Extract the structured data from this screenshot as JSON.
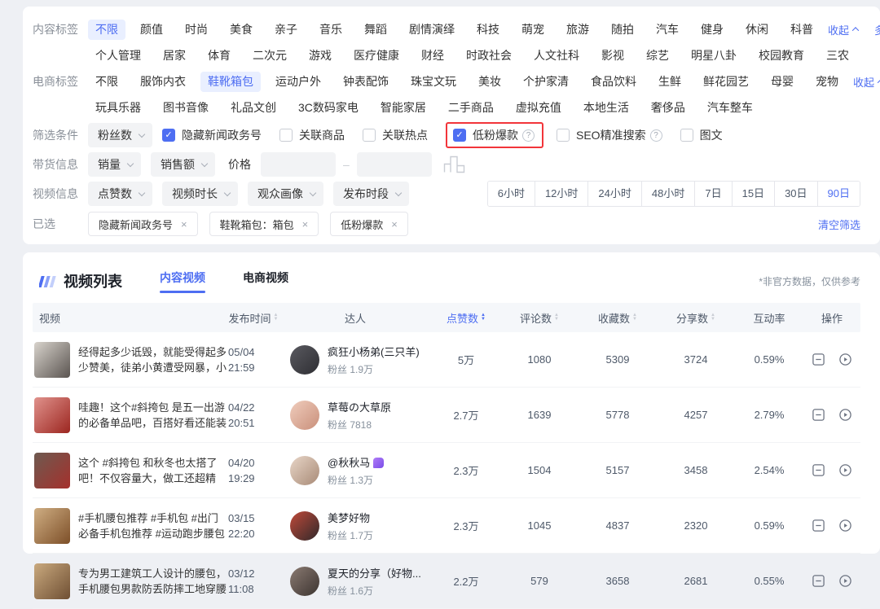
{
  "colors": {
    "accent_blue": "#4e6ef2",
    "accent_blue_bg": "#e9efff",
    "highlight_red": "#f2353a",
    "table_header_bg": "#f5f7fa"
  },
  "filter_panel": {
    "content_tags": {
      "label": "内容标签",
      "row1": [
        "不限",
        "颜值",
        "时尚",
        "美食",
        "亲子",
        "音乐",
        "舞蹈",
        "剧情演绎",
        "科技",
        "萌宠",
        "旅游",
        "随拍",
        "汽车",
        "健身",
        "休闲",
        "科普"
      ],
      "row2": [
        "个人管理",
        "居家",
        "体育",
        "二次元",
        "游戏",
        "医疗健康",
        "财经",
        "时政社会",
        "人文社科",
        "影视",
        "综艺",
        "明星八卦",
        "校园教育",
        "三农"
      ],
      "selected": "不限",
      "collapse_label": "收起",
      "multi_label": "多选"
    },
    "ecom_tags": {
      "label": "电商标签",
      "row1": [
        "不限",
        "服饰内衣",
        "鞋靴箱包",
        "运动户外",
        "钟表配饰",
        "珠宝文玩",
        "美妆",
        "个护家清",
        "食品饮料",
        "生鲜",
        "鲜花园艺",
        "母婴",
        "宠物"
      ],
      "row2": [
        "玩具乐器",
        "图书音像",
        "礼品文创",
        "3C数码家电",
        "智能家居",
        "二手商品",
        "虚拟充值",
        "本地生活",
        "奢侈品",
        "汽车整车"
      ],
      "selected": "鞋靴箱包",
      "collapse_label": "收起"
    },
    "filter_conditions": {
      "label": "筛选条件",
      "fans_dropdown": "粉丝数",
      "checkboxes": [
        {
          "label": "隐藏新闻政务号",
          "checked": true,
          "help": false,
          "highlighted": false
        },
        {
          "label": "关联商品",
          "checked": false,
          "help": false,
          "highlighted": false
        },
        {
          "label": "关联热点",
          "checked": false,
          "help": false,
          "highlighted": false
        },
        {
          "label": "低粉爆款",
          "checked": true,
          "help": true,
          "highlighted": true
        },
        {
          "label": "SEO精准搜索",
          "checked": false,
          "help": true,
          "highlighted": false
        },
        {
          "label": "图文",
          "checked": false,
          "help": false,
          "highlighted": false
        }
      ]
    },
    "commerce_info": {
      "label": "带货信息",
      "dropdowns": [
        "销量",
        "销售额"
      ],
      "price_label": "价格",
      "range_separator": "–"
    },
    "video_info": {
      "label": "视频信息",
      "dropdowns": [
        "点赞数",
        "视频时长",
        "观众画像",
        "发布时段"
      ],
      "time_buttons": [
        "6小时",
        "12小时",
        "24小时",
        "48小时",
        "7日",
        "15日",
        "30日",
        "90日"
      ],
      "time_selected": "90日"
    },
    "selected_filters": {
      "label": "已选",
      "chips": [
        "隐藏新闻政务号",
        "鞋靴箱包：箱包",
        "低粉爆款"
      ],
      "clear_label": "清空筛选"
    }
  },
  "video_list": {
    "title": "视频列表",
    "tabs": [
      {
        "label": "内容视频",
        "active": true
      },
      {
        "label": "电商视频",
        "active": false
      }
    ],
    "disclaimer": "*非官方数据，仅供参考",
    "columns": [
      {
        "label": "视频",
        "sort": false,
        "active": false
      },
      {
        "label": "发布时间",
        "sort": true,
        "active": false
      },
      {
        "label": "达人",
        "sort": false,
        "active": false
      },
      {
        "label": "点赞数",
        "sort": true,
        "active": true
      },
      {
        "label": "评论数",
        "sort": true,
        "active": false
      },
      {
        "label": "收藏数",
        "sort": true,
        "active": false
      },
      {
        "label": "分享数",
        "sort": true,
        "active": false
      },
      {
        "label": "互动率",
        "sort": false,
        "active": false
      },
      {
        "label": "操作",
        "sort": false,
        "active": false
      }
    ],
    "rows": [
      {
        "title": "经得起多少诋毁，就能受得起多少赞美，徒弟小黄遭受网暴，小杨...",
        "date": "05/04",
        "time": "21:59",
        "creator": "疯狂小杨弟(三只羊)",
        "creator_emoji": false,
        "fans": "粉丝 1.9万",
        "likes": "5万",
        "comments": "1080",
        "favorites": "5309",
        "shares": "3724",
        "engagement": "0.59%",
        "thumb_colors": [
          "#d8d3cc",
          "#5a5450"
        ],
        "avatar_colors": [
          "#5a5a60",
          "#2e2e33"
        ]
      },
      {
        "title": "哇趣！这个#斜挎包 是五一出游的必备单品吧，百搭好看还能装#...",
        "date": "04/22",
        "time": "20:51",
        "creator": "草莓の大草原",
        "creator_emoji": false,
        "fans": "粉丝 7818",
        "likes": "2.7万",
        "comments": "1639",
        "favorites": "5778",
        "shares": "4257",
        "engagement": "2.79%",
        "thumb_colors": [
          "#e0928c",
          "#9c2620"
        ],
        "avatar_colors": [
          "#f0cdbd",
          "#c98f7a"
        ]
      },
      {
        "title": "这个 #斜挎包 和秋冬也太搭了吧！不仅容量大，做工还超精细...",
        "date": "04/20",
        "time": "19:29",
        "creator": "@秋秋马",
        "creator_emoji": true,
        "fans": "粉丝 1.3万",
        "likes": "2.3万",
        "comments": "1504",
        "favorites": "5157",
        "shares": "3458",
        "engagement": "2.54%",
        "thumb_colors": [
          "#6e5a50",
          "#a5302c"
        ],
        "avatar_colors": [
          "#e8d6c8",
          "#a88a76"
        ]
      },
      {
        "title": "#手机腰包推荐 #手机包 #出门必备手机包推荐 #运动跑步腰包 #",
        "date": "03/15",
        "time": "22:20",
        "creator": "美梦好物",
        "creator_emoji": false,
        "fans": "粉丝 1.7万",
        "likes": "2.3万",
        "comments": "1045",
        "favorites": "4837",
        "shares": "2320",
        "engagement": "0.59%",
        "thumb_colors": [
          "#cfae83",
          "#7d4f28"
        ],
        "avatar_colors": [
          "#c04a3a",
          "#30282a"
        ]
      },
      {
        "title": "专为男工建筑工人设计的腰包，手机腰包男款防丢防摔工地穿腰带...",
        "date": "03/12",
        "time": "11:08",
        "creator": "夏天的分享（好物...",
        "creator_emoji": false,
        "fans": "粉丝 1.6万",
        "likes": "2.2万",
        "comments": "579",
        "favorites": "3658",
        "shares": "2681",
        "engagement": "0.55%",
        "thumb_colors": [
          "#c9a97e",
          "#6f4f33"
        ],
        "avatar_colors": [
          "#8a7a72",
          "#3c3430"
        ]
      }
    ]
  }
}
